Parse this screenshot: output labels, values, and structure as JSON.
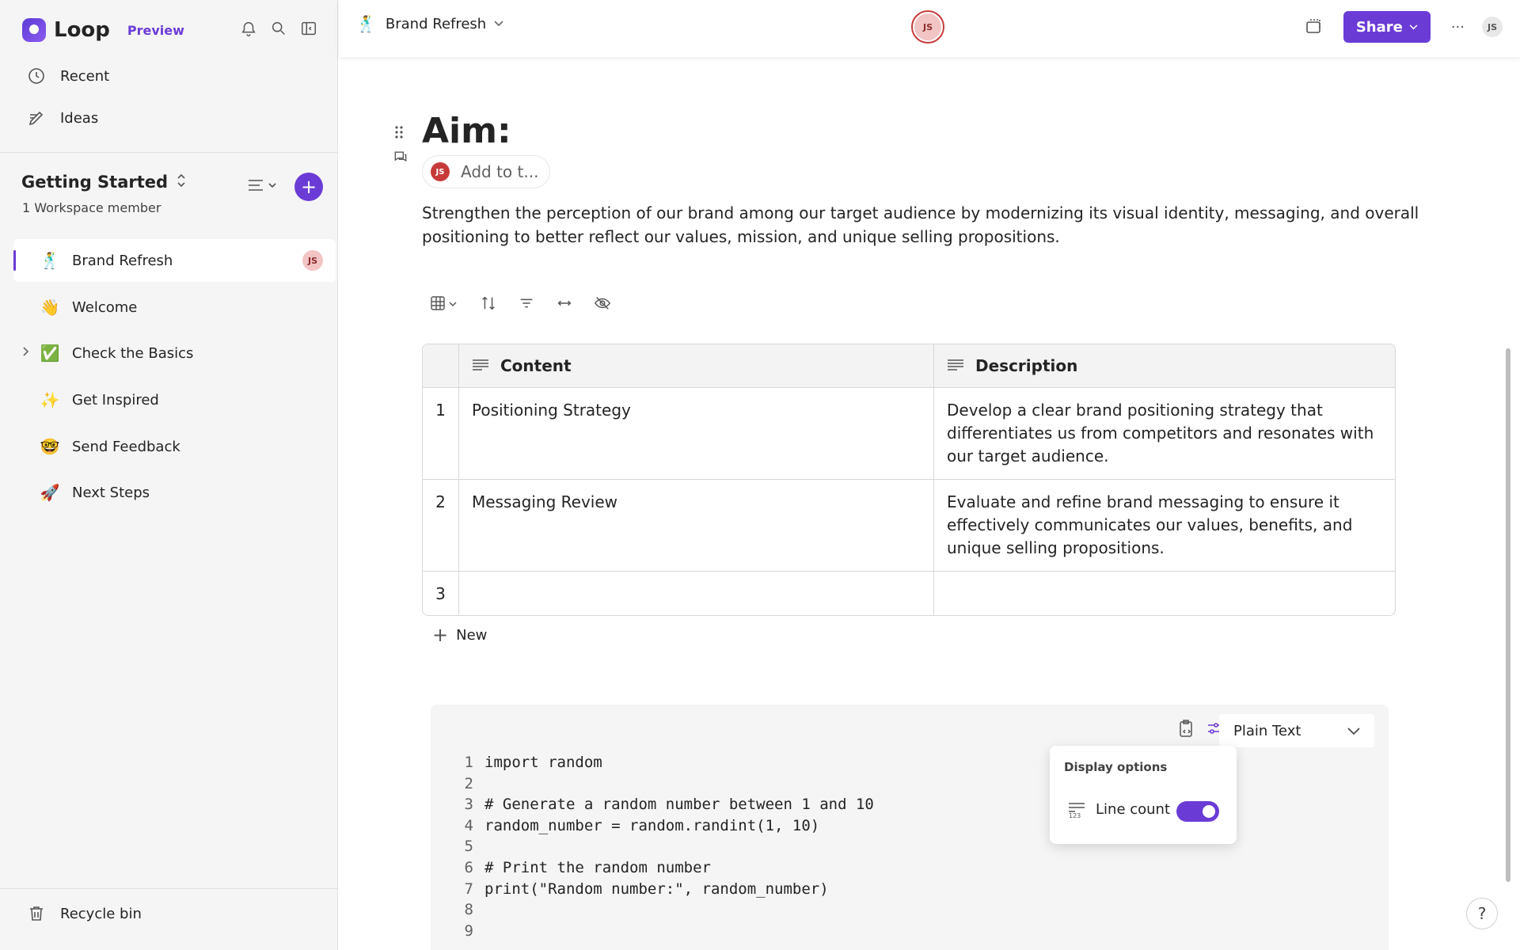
{
  "app": {
    "name": "Loop",
    "badge": "Preview"
  },
  "sidebar": {
    "nav": [
      {
        "label": "Recent",
        "icon": "clock-icon"
      },
      {
        "label": "Ideas",
        "icon": "pencil-icon"
      }
    ],
    "workspace": {
      "title": "Getting Started",
      "subtitle": "1 Workspace member"
    },
    "pages": [
      {
        "label": "Brand Refresh",
        "emoji": "🕺",
        "active": true,
        "avatar": "JS"
      },
      {
        "label": "Welcome",
        "emoji": "👋"
      },
      {
        "label": "Check the Basics",
        "emoji": "✅",
        "expandable": true
      },
      {
        "label": "Get Inspired",
        "emoji": "✨"
      },
      {
        "label": "Send Feedback",
        "emoji": "🤓"
      },
      {
        "label": "Next Steps",
        "emoji": "🚀"
      }
    ],
    "recycle": "Recycle bin"
  },
  "header": {
    "title": "Brand Refresh",
    "emoji": "🕺",
    "presence_avatar": "JS",
    "share_label": "Share",
    "more": "···",
    "user_avatar": "JS"
  },
  "doc": {
    "heading": "Aim:",
    "assign": {
      "avatar": "JS",
      "label": "Add to t..."
    },
    "paragraph": "Strengthen the perception of our brand among our target audience by modernizing its visual identity, messaging, and overall positioning to better reflect our values, mission, and unique selling propositions."
  },
  "table": {
    "headers": [
      "Content",
      "Description"
    ],
    "rows": [
      {
        "n": "1",
        "content": "Positioning Strategy",
        "description": "Develop a clear brand positioning strategy that differentiates us from competitors and resonates with our target audience."
      },
      {
        "n": "2",
        "content": "Messaging Review",
        "description": "Evaluate and refine brand messaging to ensure it effectively communicates our values, benefits, and unique selling propositions."
      },
      {
        "n": "3",
        "content": "",
        "description": ""
      }
    ],
    "new_label": "New"
  },
  "code": {
    "language": "Plain Text",
    "lines": [
      {
        "n": "1",
        "t": "import random"
      },
      {
        "n": "2",
        "t": ""
      },
      {
        "n": "3",
        "t": "# Generate a random number between 1 and 10"
      },
      {
        "n": "4",
        "t": "random_number = random.randint(1, 10)"
      },
      {
        "n": "5",
        "t": ""
      },
      {
        "n": "6",
        "t": "# Print the random number"
      },
      {
        "n": "7",
        "t": "print(\"Random number:\", random_number)"
      },
      {
        "n": "8",
        "t": ""
      },
      {
        "n": "9",
        "t": ""
      }
    ]
  },
  "display_options": {
    "title": "Display options",
    "line_count_label": "Line count",
    "line_count_on": true
  },
  "help": "?",
  "colors": {
    "accent": "#6b3bd6",
    "avatar_red": "#c73a3a"
  }
}
